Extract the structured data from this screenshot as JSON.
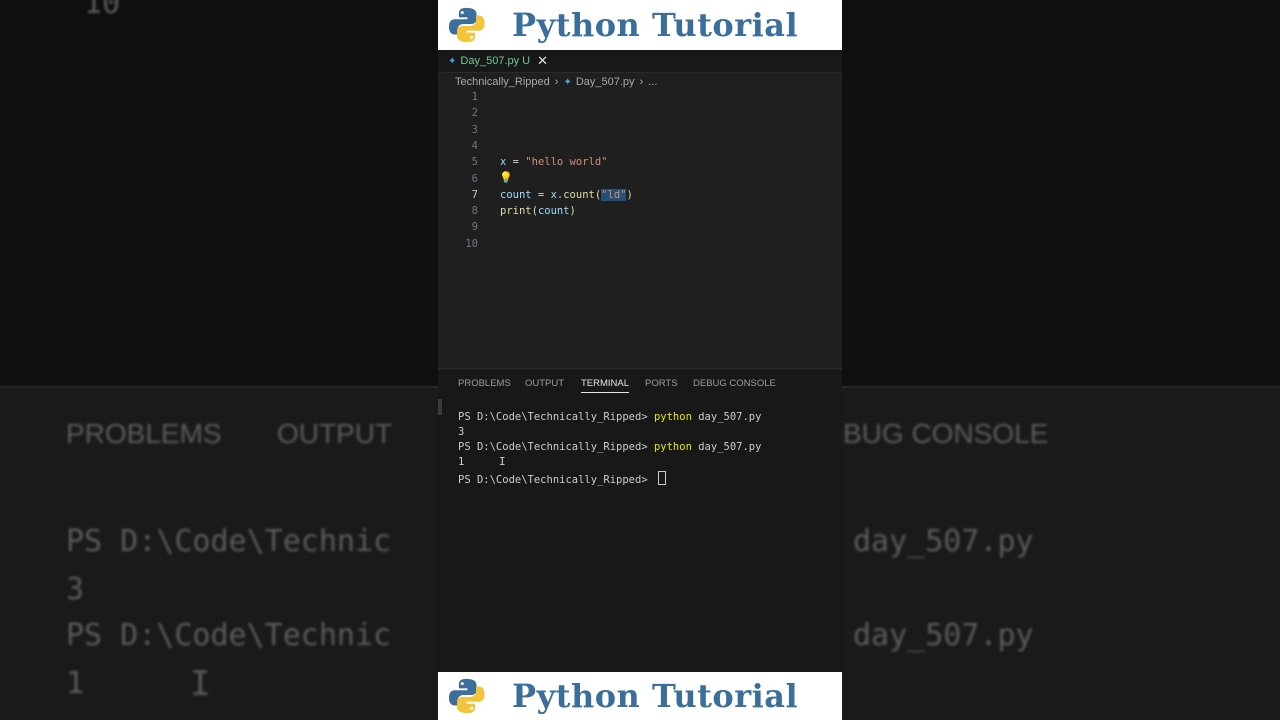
{
  "banner": {
    "title": "Python Tutorial"
  },
  "editor": {
    "tab": {
      "filename": "Day_507.py",
      "status": "U"
    },
    "breadcrumb": {
      "folder": "Technically_Ripped",
      "file": "Day_507.py",
      "more": "..."
    },
    "line_numbers": [
      "1",
      "2",
      "3",
      "4",
      "5",
      "6",
      "7",
      "8",
      "9",
      "10"
    ],
    "active_line": "7",
    "code": {
      "line5": {
        "var": "x",
        "op": " = ",
        "str": "\"hello world\""
      },
      "line7": {
        "var": "count",
        "op1": " = ",
        "obj": "x",
        "dot": ".",
        "fn": "count",
        "open": "(",
        "str": "\"ld\"",
        "close": ")"
      },
      "line8": {
        "fn": "print",
        "open": "(",
        "var": "count",
        "close": ")"
      }
    }
  },
  "panel": {
    "tabs": [
      "PROBLEMS",
      "OUTPUT",
      "TERMINAL",
      "PORTS",
      "DEBUG CONSOLE"
    ],
    "active_tab": "TERMINAL",
    "terminal": {
      "prompt": "PS D:\\Code\\Technically_Ripped> ",
      "cmd": "python",
      "arg": " day_507.py",
      "out1": "3",
      "out2": "1"
    }
  },
  "background": {
    "tab1": "PROBLEMS",
    "tab2": "OUTPUT",
    "tab3": "BUG CONSOLE",
    "ps": "PS D:\\Code\\Technic",
    "file": "day_507.py",
    "out1": "3",
    "out2": "1",
    "top_num": "10"
  },
  "colors": {
    "brand": "#3b6e9a",
    "string": "#ce9178",
    "variable": "#9cdcfe",
    "function": "#dcdcaa",
    "terminal_cmd": "#e5e510",
    "selection": "#264f78"
  }
}
